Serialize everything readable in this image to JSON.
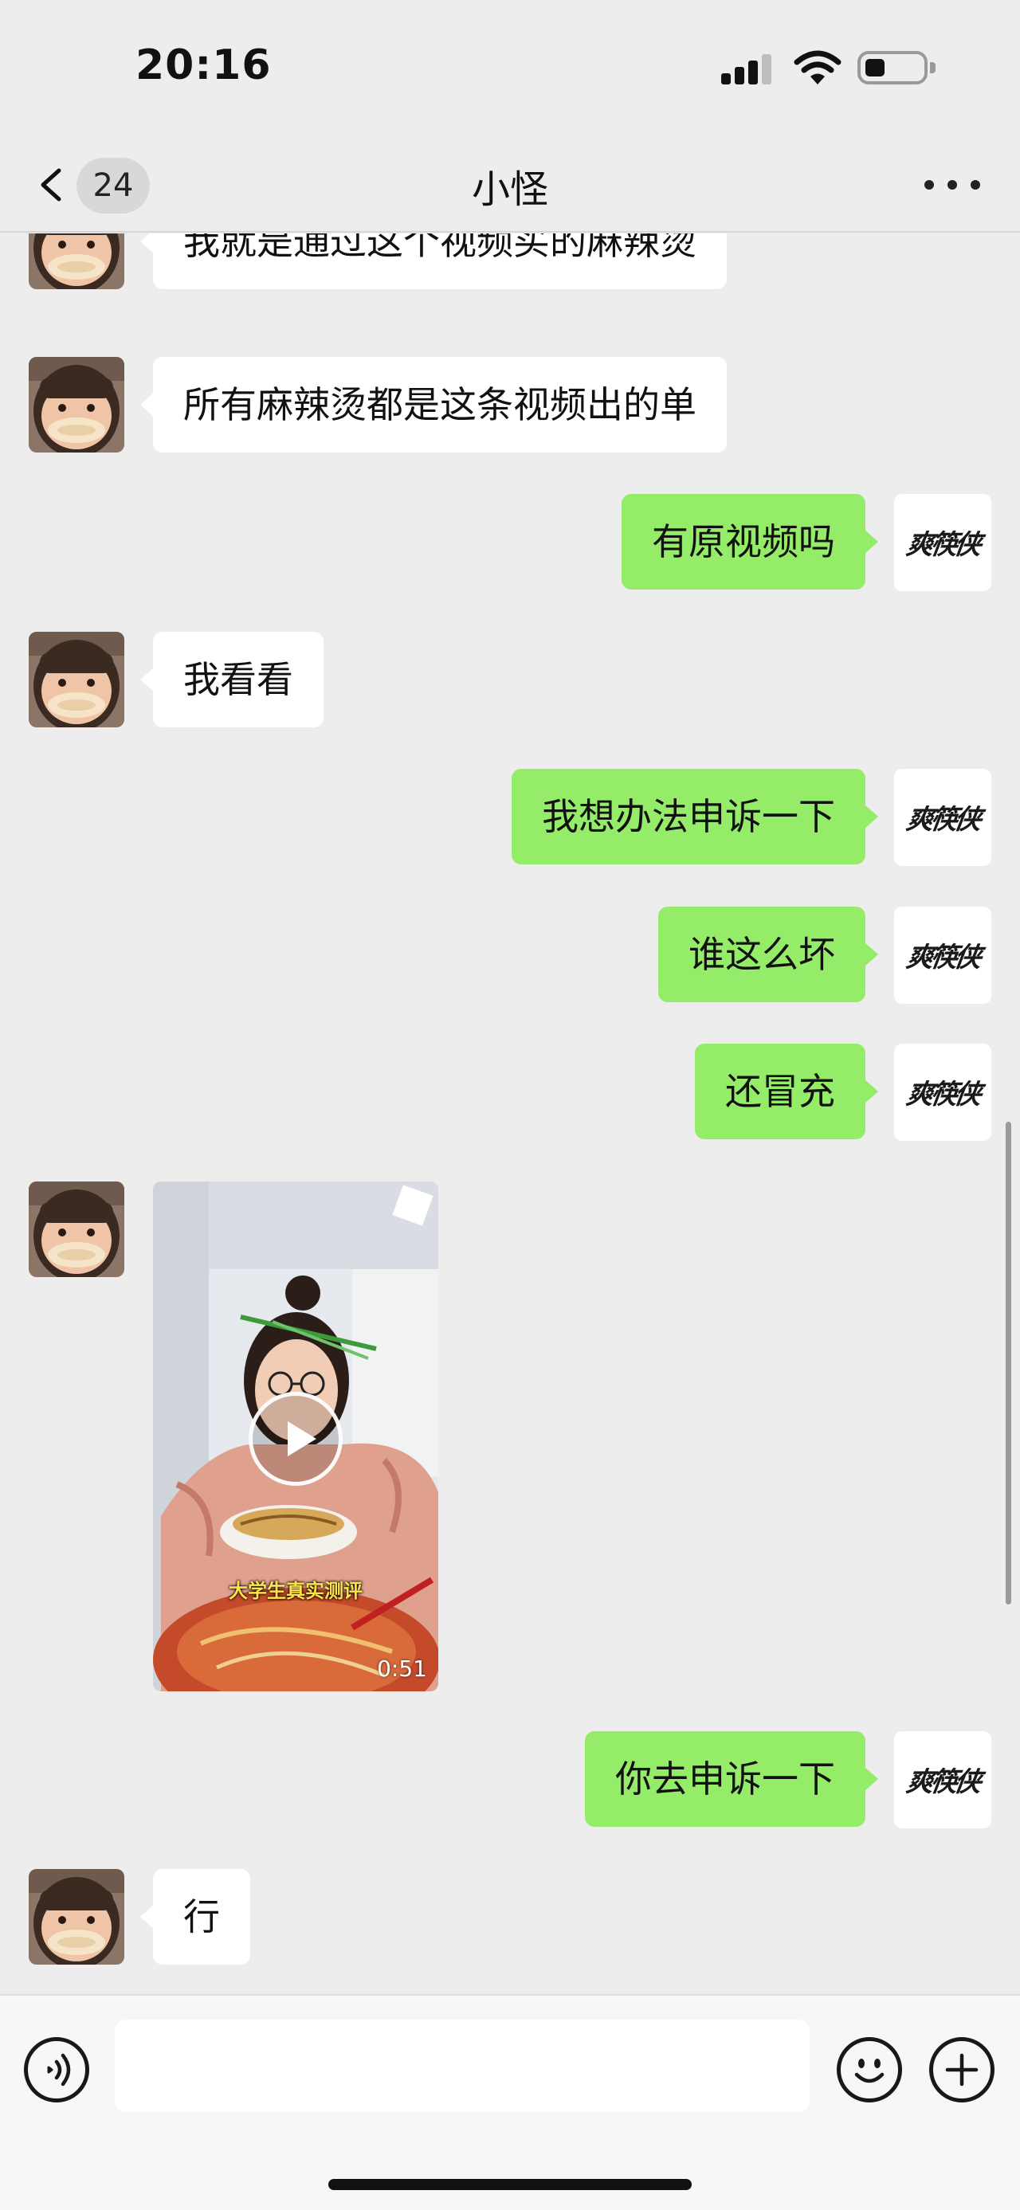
{
  "status_bar": {
    "time": "20:16"
  },
  "nav": {
    "title": "小怪",
    "unread_count": "24"
  },
  "messages": [
    {
      "side": "in",
      "text": "我就是通过这个视频买的麻辣烫"
    },
    {
      "side": "in",
      "text": "所有麻辣烫都是这条视频出的单"
    },
    {
      "side": "out",
      "text": "有原视频吗"
    },
    {
      "side": "in",
      "text": "我看看"
    },
    {
      "side": "out",
      "text": "我想办法申诉一下"
    },
    {
      "side": "out",
      "text": "谁这么坏"
    },
    {
      "side": "out",
      "text": "还冒充"
    },
    {
      "side": "in",
      "type": "video",
      "caption": "大学生真实测评",
      "duration": "0:51"
    },
    {
      "side": "out",
      "text": "你去申诉一下"
    },
    {
      "side": "in",
      "text": "行"
    }
  ],
  "own_avatar": {
    "logo_text": "爽筷侠"
  },
  "input": {
    "value": "",
    "placeholder": ""
  },
  "icons": {
    "back": "chevron-left-icon",
    "more": "more-dots-icon",
    "voice": "voice-icon",
    "emoji": "emoji-icon",
    "plus": "plus-icon",
    "play": "play-icon"
  },
  "colors": {
    "background": "#ededed",
    "outgoing_bubble": "#95ec69",
    "incoming_bubble": "#ffffff"
  }
}
